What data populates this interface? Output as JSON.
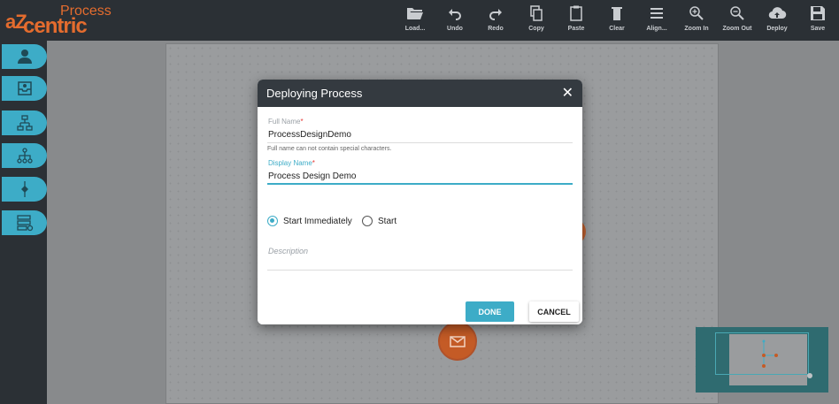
{
  "app": {
    "logo_small": "aZ",
    "logo_main": "centric",
    "logo_product": "Process"
  },
  "toolbar": {
    "items": [
      {
        "label": "Load...",
        "icon": "folder-open-icon"
      },
      {
        "label": "Undo",
        "icon": "undo-icon"
      },
      {
        "label": "Redo",
        "icon": "redo-icon"
      },
      {
        "label": "Copy",
        "icon": "copy-icon"
      },
      {
        "label": "Paste",
        "icon": "paste-icon"
      },
      {
        "label": "Clear",
        "icon": "trash-icon"
      },
      {
        "label": "Align...",
        "icon": "align-icon"
      },
      {
        "label": "Zoom In",
        "icon": "zoom-in-icon"
      },
      {
        "label": "Zoom Out",
        "icon": "zoom-out-icon"
      },
      {
        "label": "Deploy",
        "icon": "cloud-upload-icon"
      },
      {
        "label": "Save",
        "icon": "save-icon"
      }
    ]
  },
  "sidebar": {
    "items": [
      {
        "icon": "user-icon"
      },
      {
        "icon": "inbox-icon"
      },
      {
        "icon": "hierarchy-icon"
      },
      {
        "icon": "tree-icon"
      },
      {
        "icon": "flow-icon"
      },
      {
        "icon": "server-settings-icon"
      }
    ]
  },
  "dialog": {
    "title": "Deploying Process",
    "full_name": {
      "label": "Full Name",
      "required_mark": "*",
      "value": "ProcessDesignDemo",
      "hint": "Full name can not contain special characters."
    },
    "display_name": {
      "label": "Display Name",
      "required_mark": "*",
      "value": "Process Design Demo"
    },
    "start_options": [
      {
        "label": "Start Immediately",
        "selected": true
      },
      {
        "label": "Start",
        "selected": false
      }
    ],
    "description_placeholder": "Description",
    "done_label": "DONE",
    "cancel_label": "CANCEL"
  },
  "colors": {
    "accent": "#3dacc7",
    "topbar": "#2b3035",
    "node": "#c45b26",
    "required": "#e53935"
  }
}
